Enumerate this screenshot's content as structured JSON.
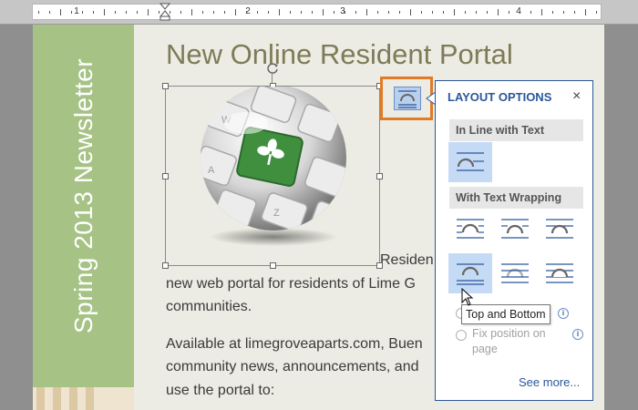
{
  "ruler": {
    "numbers": [
      "1",
      "2",
      "3",
      "4"
    ]
  },
  "sidebar": {
    "text": "Spring 2013 Newsletter"
  },
  "document": {
    "title": "New Online Resident Portal",
    "paragraphs": [
      "Residen",
      "new web portal for residents of Lime G",
      "communities.",
      "Available at limegroveaparts.com, Buen",
      "community news, announcements, and",
      "use the portal to:"
    ]
  },
  "layout_panel": {
    "title": "LAYOUT OPTIONS",
    "close_icon": "×",
    "inline_header": "In Line with Text",
    "wrap_header": "With Text Wrapping",
    "tooltip": "Top and Bottom",
    "fix_position_label": "Fix position on page",
    "move_with_text_icon": "i",
    "see_more": "See more..."
  },
  "colors": {
    "accent": "#2b579a",
    "highlight_border": "#e07b26",
    "sidebar_green": "#a6c285",
    "title_color": "#7e7b58"
  }
}
